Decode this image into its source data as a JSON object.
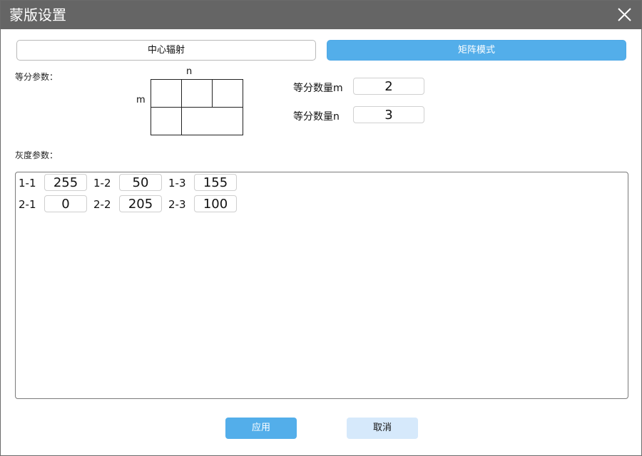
{
  "window": {
    "title": "蒙版设置"
  },
  "modes": {
    "center": "中心辐射",
    "matrix": "矩阵模式",
    "active": "matrix"
  },
  "divide": {
    "section_label": "等分参数：",
    "diagram": {
      "n_label": "n",
      "m_label": "m"
    },
    "m_label": "等分数量m",
    "m_value": "2",
    "n_label": "等分数量n",
    "n_value": "3"
  },
  "gray": {
    "section_label": "灰度参数：",
    "cells": [
      {
        "label": "1-1",
        "value": "255"
      },
      {
        "label": "1-2",
        "value": "50"
      },
      {
        "label": "1-3",
        "value": "155"
      },
      {
        "label": "2-1",
        "value": "0"
      },
      {
        "label": "2-2",
        "value": "205"
      },
      {
        "label": "2-3",
        "value": "100"
      }
    ]
  },
  "actions": {
    "apply": "应用",
    "cancel": "取消"
  },
  "colors": {
    "titlebar": "#656565",
    "accent": "#53aeea",
    "cancel_bg": "#d6e9fb"
  },
  "icons": {
    "close": "close-icon"
  }
}
